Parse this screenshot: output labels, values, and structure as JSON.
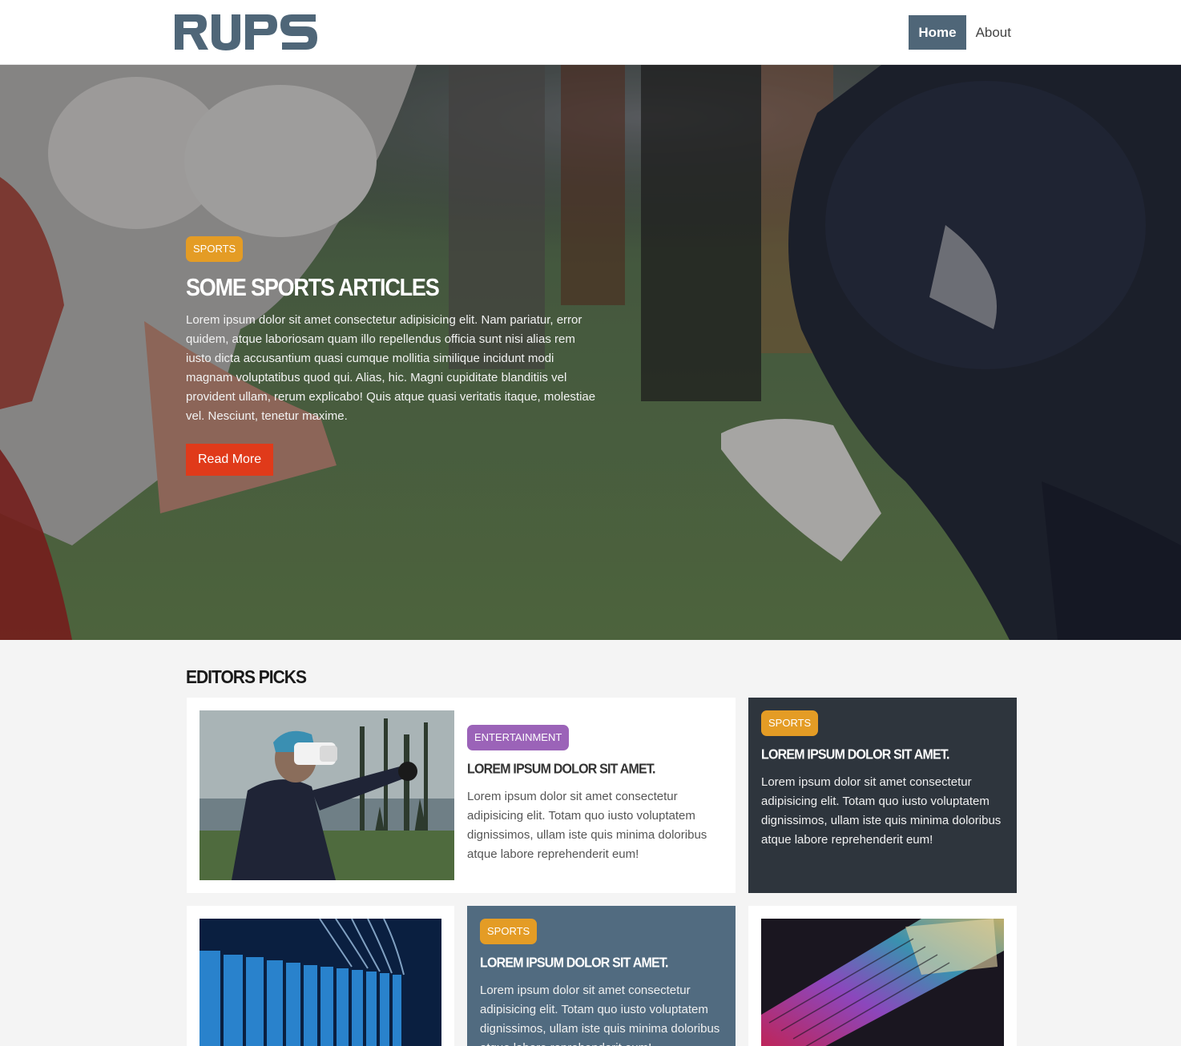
{
  "brand": {
    "logo_text": "RUPS",
    "logo_color": "#4f6678"
  },
  "nav": {
    "items": [
      {
        "label": "Home",
        "active": true
      },
      {
        "label": "About",
        "active": false
      }
    ]
  },
  "hero": {
    "category": "SPORTS",
    "title": "Some Sports Articles",
    "text": "Lorem ipsum dolor sit amet consectetur adipisicing elit. Nam pariatur, error quidem, atque laboriosam quam illo repellendus officia sunt nisi alias rem iusto dicta accusantium quasi cumque mollitia similique incidunt modi magnam voluptatibus quod qui. Alias, hic. Magni cupiditate blanditiis vel provident ullam, rerum explicabo! Quis atque quasi veritatis itaque, molestiae vel. Nesciunt, tenetur maxime.",
    "button": "Read More"
  },
  "editors_picks": {
    "title": "Editors Picks",
    "cards": [
      {
        "category": "ENTERTAINMENT",
        "title": "Lorem ipsum dolor sit amet.",
        "text": "Lorem ipsum dolor sit amet consectetur adipisicing elit. Totam quo iusto voluptatem dignissimos, ullam iste quis minima doloribus atque labore reprehenderit eum!"
      },
      {
        "category": "SPORTS",
        "title": "Lorem ipsum dolor sit amet.",
        "text": "Lorem ipsum dolor sit amet consectetur adipisicing elit. Totam quo iusto voluptatem dignissimos, ullam iste quis minima doloribus atque labore reprehenderit eum!"
      },
      {
        "category": "SPORTS",
        "title": "Lorem ipsum dolor sit amet.",
        "text": "Lorem ipsum dolor sit amet consectetur adipisicing elit. Totam quo iusto voluptatem dignissimos, ullam iste quis minima doloribus atque labore reprehenderit eum!"
      }
    ]
  },
  "colors": {
    "accent_orange": "#e49c25",
    "accent_purple": "#9b63b8",
    "button_red": "#e03a1a",
    "dark_card": "#2e353d",
    "slate_card": "#516b80"
  }
}
